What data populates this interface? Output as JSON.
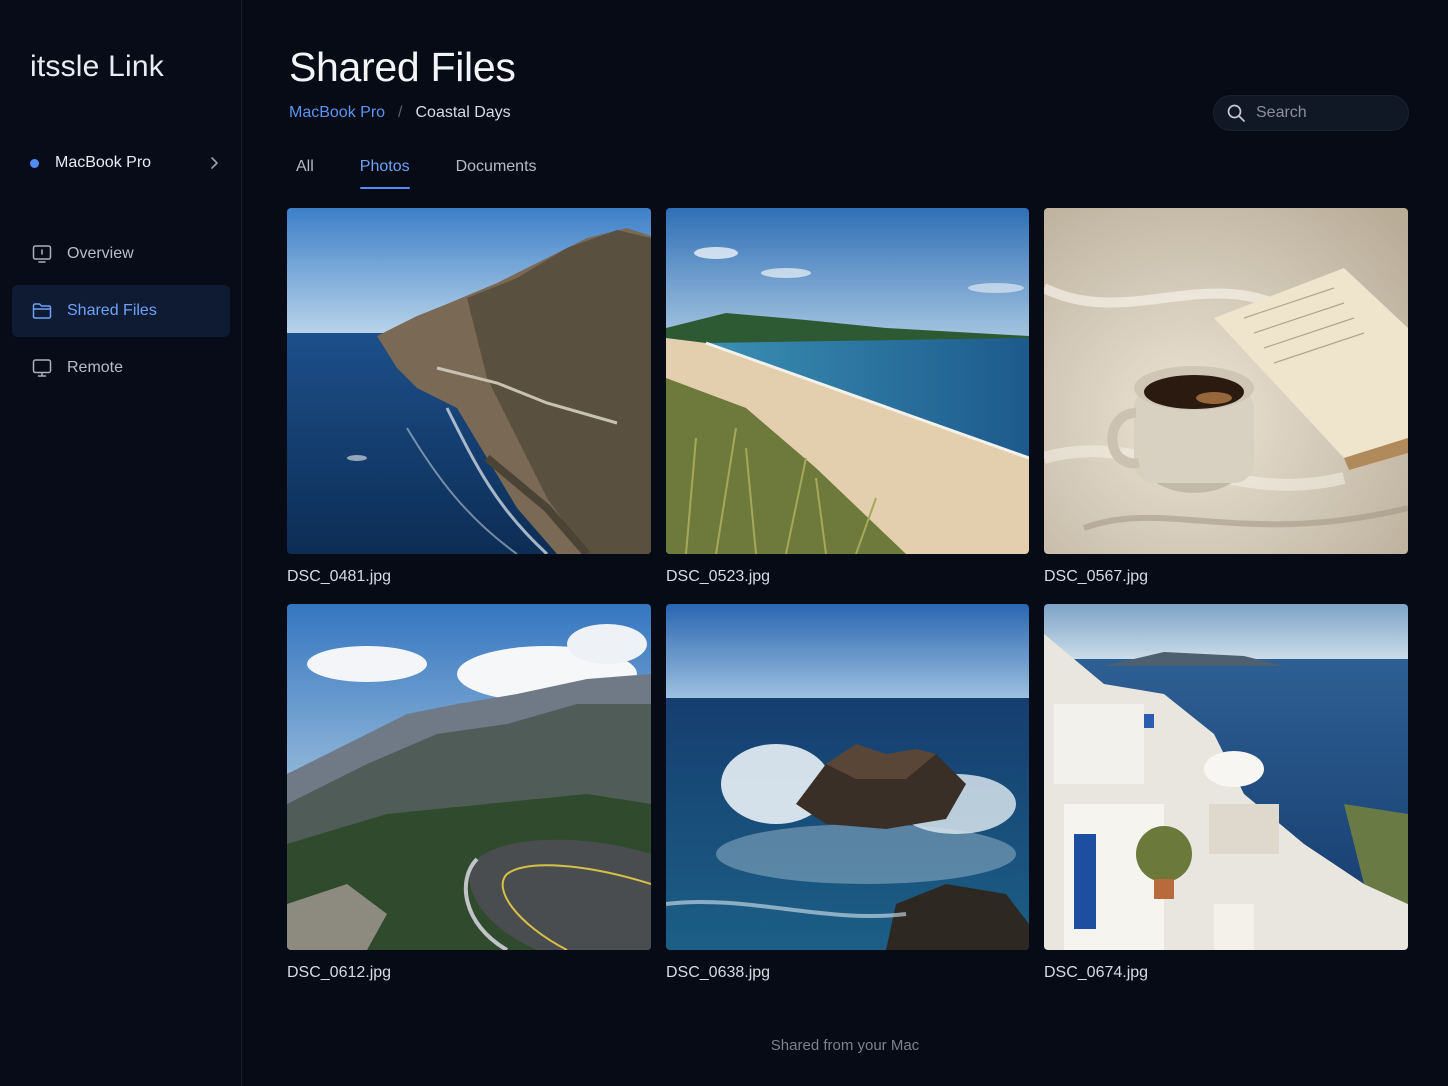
{
  "app": {
    "name": "itssle Link"
  },
  "sidebar": {
    "device": {
      "name": "MacBook Pro",
      "status_color": "#4f8cf7"
    },
    "items": [
      {
        "label": "Overview",
        "icon": "display-info-icon"
      },
      {
        "label": "Shared Files",
        "icon": "folder-icon",
        "active": true
      },
      {
        "label": "Remote",
        "icon": "monitor-icon"
      }
    ]
  },
  "header": {
    "title": "Shared Files",
    "breadcrumb": {
      "root": "MacBook Pro",
      "separator": "/",
      "current": "Coastal Days"
    },
    "search": {
      "placeholder": "Search",
      "value": ""
    }
  },
  "tabs": [
    {
      "label": "All"
    },
    {
      "label": "Photos",
      "active": true
    },
    {
      "label": "Documents"
    }
  ],
  "files": [
    {
      "name": "DSC_0481.jpg",
      "scene": "coastal cliffs highway"
    },
    {
      "name": "DSC_0523.jpg",
      "scene": "sandy beach with dune grass"
    },
    {
      "name": "DSC_0567.jpg",
      "scene": "coffee mug and open book on linen"
    },
    {
      "name": "DSC_0612.jpg",
      "scene": "mountain road with clouds"
    },
    {
      "name": "DSC_0638.jpg",
      "scene": "waves crashing on rocks"
    },
    {
      "name": "DSC_0674.jpg",
      "scene": "white village above the sea"
    }
  ],
  "footer": {
    "text": "Shared from your Mac"
  },
  "colors": {
    "accent": "#4f8cf7",
    "background": "#060b16",
    "sidebar_active": "#0f1b33"
  }
}
